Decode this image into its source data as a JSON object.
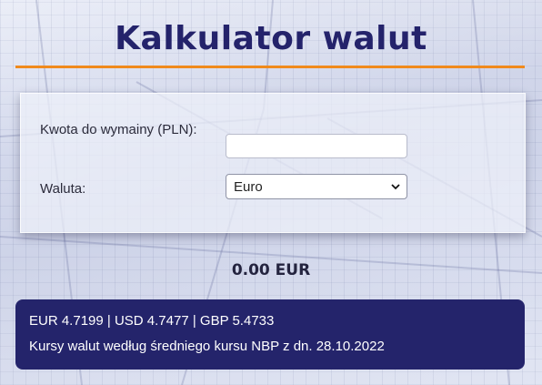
{
  "header": {
    "title": "Kalkulator walut",
    "accent_color": "#f08a1c",
    "title_color": "#24236b"
  },
  "form": {
    "amount_label": "Kwota do wymainy (PLN):",
    "amount_value": "",
    "amount_placeholder": "",
    "currency_label": "Waluta:",
    "currency_selected": "Euro"
  },
  "result": {
    "value": "0.00 EUR"
  },
  "rates": {
    "summary": "EUR 4.7199 | USD 4.7477 | GBP 5.4733",
    "note": "Kursy walut według średniego kursu NBP z dn. 28.10.2022",
    "box_color": "#24246b"
  },
  "icons": {
    "select_arrow": "chevron-down-icon"
  }
}
